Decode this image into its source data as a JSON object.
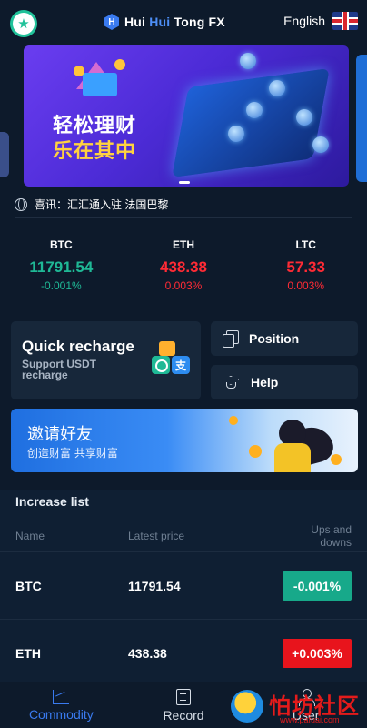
{
  "header": {
    "brand_part1": "Hui ",
    "brand_part2": "Hui",
    "brand_part3": " Tong FX",
    "brand_icon_letter": "H",
    "language": "English",
    "flag_icon": "uk-flag-icon"
  },
  "banner": {
    "line1": "轻松理财",
    "line2": "乐在其中"
  },
  "notice": {
    "text": "喜讯：汇汇通入驻 法国巴黎"
  },
  "tickers": [
    {
      "symbol": "BTC",
      "price": "11791.54",
      "change": "-0.001%",
      "trend": "up"
    },
    {
      "symbol": "ETH",
      "price": "438.38",
      "change": "0.003%",
      "trend": "down"
    },
    {
      "symbol": "LTC",
      "price": "57.33",
      "change": "0.003%",
      "trend": "down"
    }
  ],
  "quick": {
    "title": "Quick recharge",
    "subtitle": "Support USDT recharge",
    "pay_char": "支"
  },
  "side_buttons": {
    "position": "Position",
    "help": "Help"
  },
  "invite": {
    "title": "邀请好友",
    "subtitle": "创造财富 共享财富"
  },
  "increase_list": {
    "title": "Increase list",
    "headers": {
      "name": "Name",
      "price": "Latest price",
      "change": "Ups and downs"
    },
    "rows": [
      {
        "name": "BTC",
        "price": "11791.54",
        "change": "-0.001%",
        "color": "#17a98a"
      },
      {
        "name": "ETH",
        "price": "438.38",
        "change": "+0.003%",
        "color": "#e8141c"
      }
    ]
  },
  "nav": {
    "commodity": "Commodity",
    "record": "Record",
    "user": "User"
  },
  "watermark": {
    "text": "怕坊社区",
    "url": "www.pafuai.com"
  },
  "colors": {
    "background": "#0d1a2b",
    "accent": "#3a7bf0",
    "up": "#1fb996",
    "down": "#ff2b35"
  }
}
